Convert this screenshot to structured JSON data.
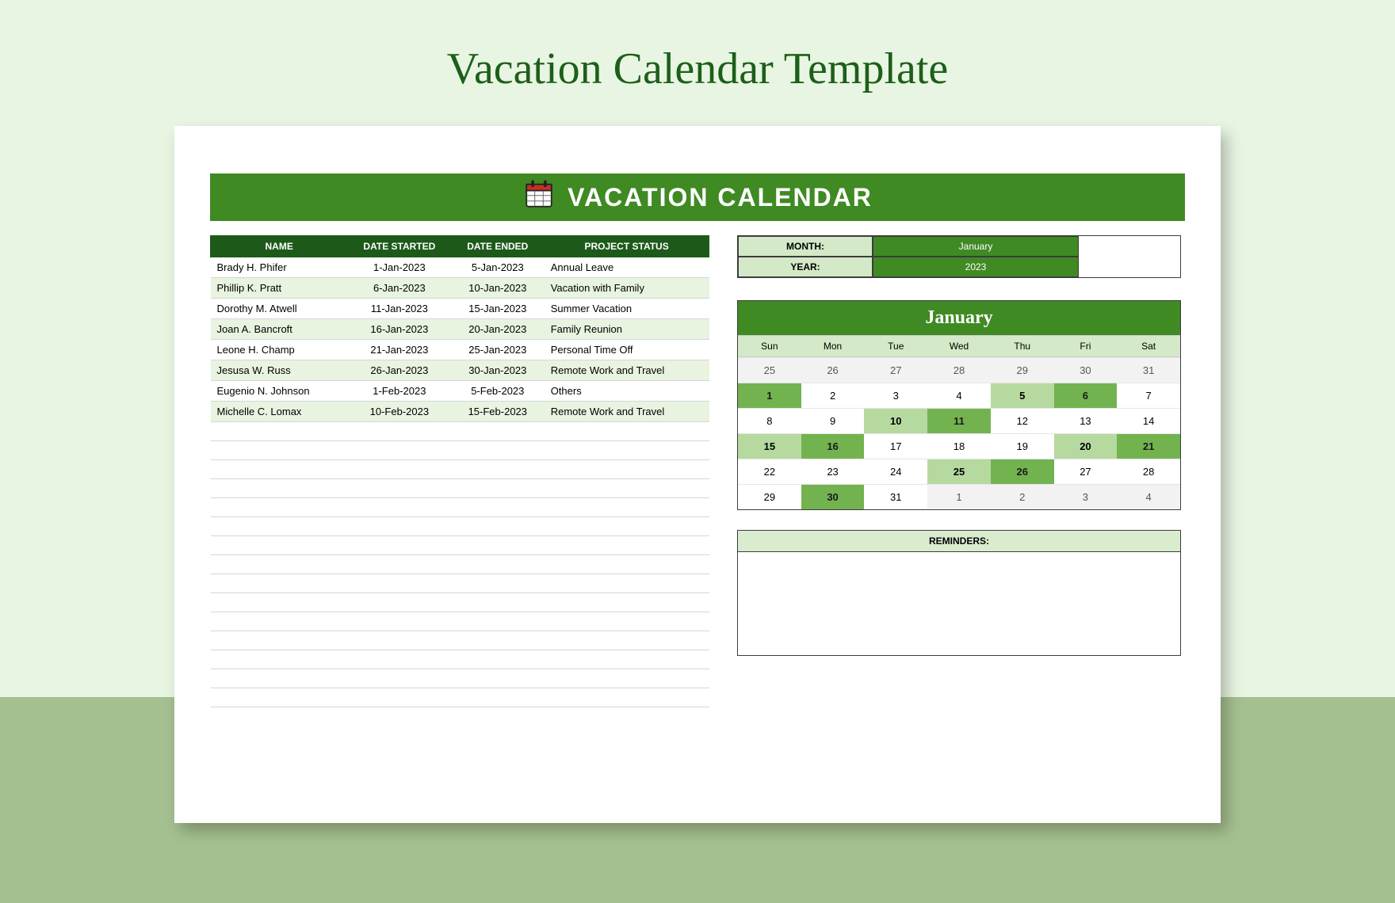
{
  "page_title": "Vacation Calendar Template",
  "banner_title": "VACATION CALENDAR",
  "table": {
    "headers": [
      "NAME",
      "DATE STARTED",
      "DATE ENDED",
      "PROJECT STATUS"
    ],
    "rows": [
      {
        "name": "Brady H. Phifer",
        "start": "1-Jan-2023",
        "end": "5-Jan-2023",
        "status": "Annual Leave"
      },
      {
        "name": "Phillip K. Pratt",
        "start": "6-Jan-2023",
        "end": "10-Jan-2023",
        "status": "Vacation with Family"
      },
      {
        "name": "Dorothy M. Atwell",
        "start": "11-Jan-2023",
        "end": "15-Jan-2023",
        "status": "Summer Vacation"
      },
      {
        "name": "Joan A. Bancroft",
        "start": "16-Jan-2023",
        "end": "20-Jan-2023",
        "status": "Family Reunion"
      },
      {
        "name": "Leone H. Champ",
        "start": "21-Jan-2023",
        "end": "25-Jan-2023",
        "status": "Personal Time Off"
      },
      {
        "name": "Jesusa W. Russ",
        "start": "26-Jan-2023",
        "end": "30-Jan-2023",
        "status": "Remote Work and Travel"
      },
      {
        "name": "Eugenio N. Johnson",
        "start": "1-Feb-2023",
        "end": "5-Feb-2023",
        "status": "Others"
      },
      {
        "name": "Michelle C. Lomax",
        "start": "10-Feb-2023",
        "end": "15-Feb-2023",
        "status": "Remote Work and Travel"
      }
    ],
    "empty_rows": 15
  },
  "selectors": {
    "month_label": "MONTH:",
    "month_value": "January",
    "year_label": "YEAR:",
    "year_value": "2023"
  },
  "calendar": {
    "month_name": "January",
    "dow": [
      "Sun",
      "Mon",
      "Tue",
      "Wed",
      "Thu",
      "Fri",
      "Sat"
    ],
    "cells": [
      {
        "n": "25",
        "cls": "out"
      },
      {
        "n": "26",
        "cls": "out"
      },
      {
        "n": "27",
        "cls": "out"
      },
      {
        "n": "28",
        "cls": "out"
      },
      {
        "n": "29",
        "cls": "out"
      },
      {
        "n": "30",
        "cls": "out"
      },
      {
        "n": "31",
        "cls": "out"
      },
      {
        "n": "1",
        "cls": "hl2"
      },
      {
        "n": "2",
        "cls": ""
      },
      {
        "n": "3",
        "cls": ""
      },
      {
        "n": "4",
        "cls": ""
      },
      {
        "n": "5",
        "cls": "hl1"
      },
      {
        "n": "6",
        "cls": "hl2"
      },
      {
        "n": "7",
        "cls": ""
      },
      {
        "n": "8",
        "cls": ""
      },
      {
        "n": "9",
        "cls": ""
      },
      {
        "n": "10",
        "cls": "hl1"
      },
      {
        "n": "11",
        "cls": "hl2"
      },
      {
        "n": "12",
        "cls": ""
      },
      {
        "n": "13",
        "cls": ""
      },
      {
        "n": "14",
        "cls": ""
      },
      {
        "n": "15",
        "cls": "hl1"
      },
      {
        "n": "16",
        "cls": "hl2"
      },
      {
        "n": "17",
        "cls": ""
      },
      {
        "n": "18",
        "cls": ""
      },
      {
        "n": "19",
        "cls": ""
      },
      {
        "n": "20",
        "cls": "hl1"
      },
      {
        "n": "21",
        "cls": "hl2"
      },
      {
        "n": "22",
        "cls": ""
      },
      {
        "n": "23",
        "cls": ""
      },
      {
        "n": "24",
        "cls": ""
      },
      {
        "n": "25",
        "cls": "hl1"
      },
      {
        "n": "26",
        "cls": "hl2"
      },
      {
        "n": "27",
        "cls": ""
      },
      {
        "n": "28",
        "cls": ""
      },
      {
        "n": "29",
        "cls": ""
      },
      {
        "n": "30",
        "cls": "hl2"
      },
      {
        "n": "31",
        "cls": ""
      },
      {
        "n": "1",
        "cls": "out"
      },
      {
        "n": "2",
        "cls": "out"
      },
      {
        "n": "3",
        "cls": "out"
      },
      {
        "n": "4",
        "cls": "out"
      }
    ]
  },
  "reminders_label": "REMINDERS:"
}
